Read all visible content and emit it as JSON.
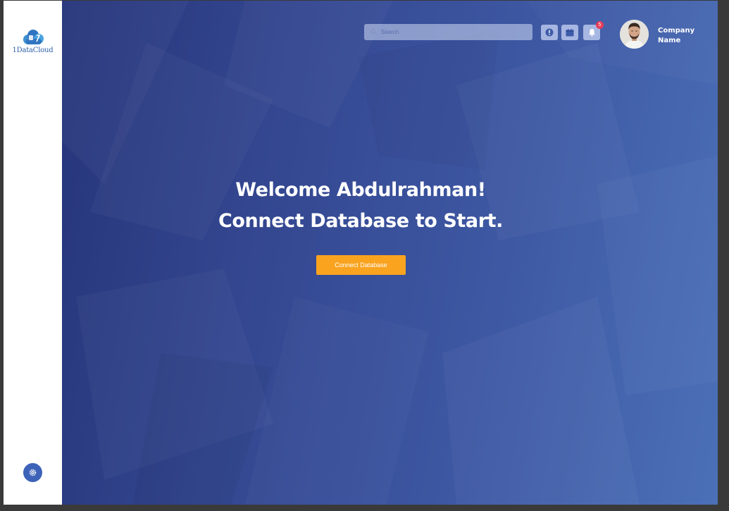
{
  "brand": {
    "name": "1DataCloud"
  },
  "header": {
    "search_placeholder": "Search",
    "notification_count": "5",
    "company_line1": "Company",
    "company_line2": "Name"
  },
  "hero": {
    "line1": "Welcome Abdulrahman!",
    "line2": "Connect Database to Start.",
    "button_label": "Connect Database"
  },
  "icons": {
    "search": "search-icon",
    "info": "info-icon",
    "calendar": "calendar-icon",
    "notifications": "bell-icon",
    "settings": "gear-icon"
  },
  "colors": {
    "sidebar": "#ffffff",
    "accent": "#f9a31f",
    "brand_blue": "#2f5fa8",
    "badge": "#e63d5a",
    "background_start": "#26357a",
    "background_end": "#4b70b8"
  }
}
